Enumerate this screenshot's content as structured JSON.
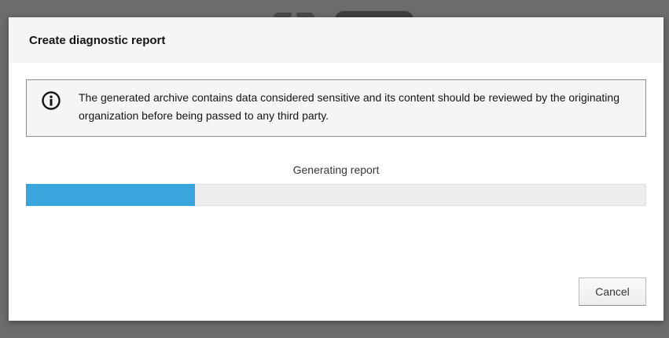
{
  "dialog": {
    "title": "Create diagnostic report",
    "alert": {
      "icon": "info-circle-icon",
      "text": "The generated archive contains data considered sensitive and its content should be reviewed by the originating organization before being passed to any third party."
    },
    "progress": {
      "label": "Generating report",
      "fraction": 0.273,
      "color": "#39a5dc"
    },
    "cancel_label": "Cancel"
  }
}
